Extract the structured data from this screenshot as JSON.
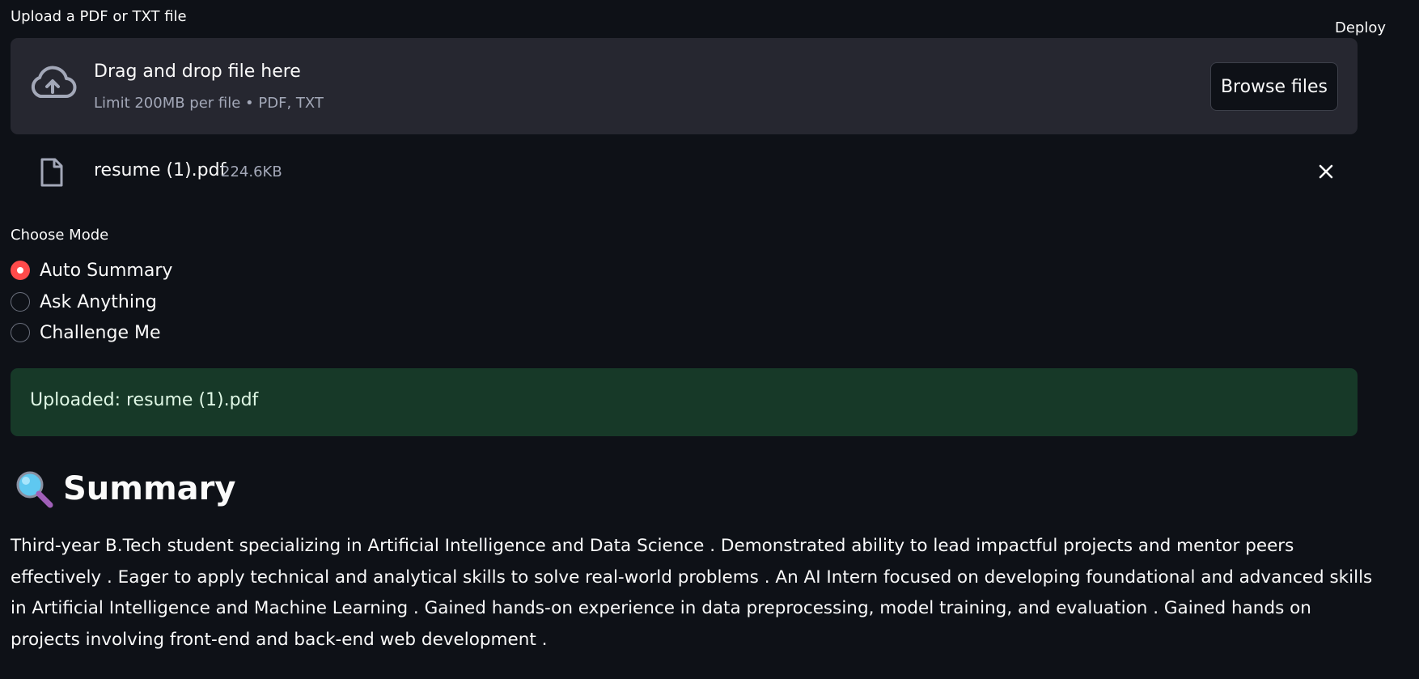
{
  "header": {
    "deploy_label": "Deploy"
  },
  "uploader": {
    "label": "Upload a PDF or TXT file",
    "drop_title": "Drag and drop file here",
    "drop_limit": "Limit 200MB per file • PDF, TXT",
    "browse_label": "Browse files"
  },
  "file": {
    "name": "resume (1).pdf",
    "size": "224.6KB"
  },
  "mode": {
    "label": "Choose Mode",
    "options": [
      {
        "label": "Auto Summary",
        "selected": true
      },
      {
        "label": "Ask Anything",
        "selected": false
      },
      {
        "label": "Challenge Me",
        "selected": false
      }
    ]
  },
  "status": {
    "message": "Uploaded: resume (1).pdf"
  },
  "summary": {
    "heading": "Summary",
    "body": "Third-year B.Tech student specializing in Artificial Intelligence and Data Science . Demonstrated ability to lead impactful projects and mentor peers effectively . Eager to apply technical and analytical skills to solve real-world problems . An AI Intern focused on developing foundational and advanced skills in Artificial Intelligence and Machine Learning . Gained hands-on experience in data preprocessing, model training, and evaluation . Gained hands on projects involving front-end and back-end web development ."
  },
  "colors": {
    "background": "#0e1117",
    "dropzone": "#262730",
    "accent": "#ff4b4b",
    "success_bg": "#173928"
  }
}
